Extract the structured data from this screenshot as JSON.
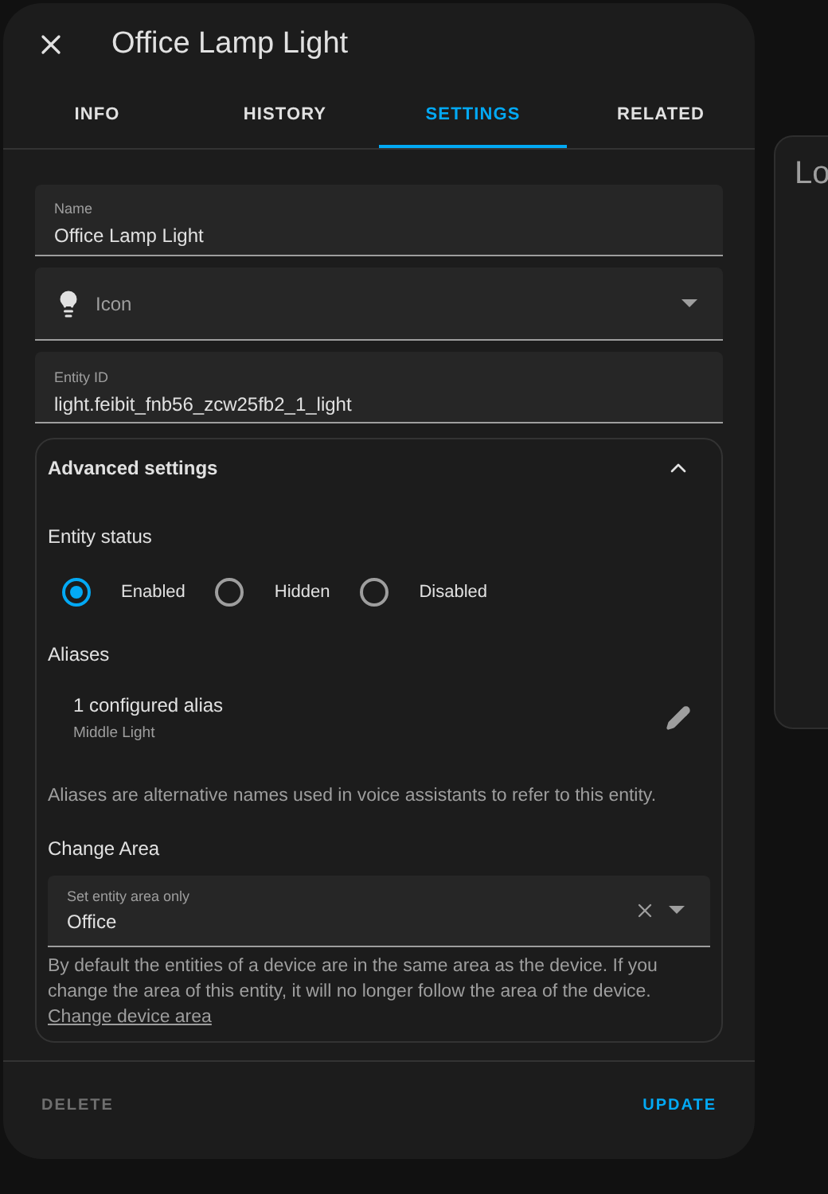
{
  "background_card": {
    "title": "Lo"
  },
  "dialog": {
    "title": "Office Lamp Light"
  },
  "tabs": [
    {
      "label": "INFO",
      "selected": false
    },
    {
      "label": "HISTORY",
      "selected": false
    },
    {
      "label": "SETTINGS",
      "selected": true
    },
    {
      "label": "RELATED",
      "selected": false
    }
  ],
  "name_field": {
    "label": "Name",
    "value": "Office Lamp Light"
  },
  "icon_field": {
    "placeholder": "Icon"
  },
  "entity_id_field": {
    "label": "Entity ID",
    "value": "light.feibit_fnb56_zcw25fb2_1_light"
  },
  "advanced": {
    "title": "Advanced settings",
    "expanded": true,
    "entity_status": {
      "heading": "Entity status",
      "options": [
        {
          "label": "Enabled",
          "selected": true
        },
        {
          "label": "Hidden",
          "selected": false
        },
        {
          "label": "Disabled",
          "selected": false
        }
      ]
    },
    "aliases": {
      "heading": "Aliases",
      "summary": "1 configured alias",
      "detail": "Middle Light",
      "help": "Aliases are alternative names used in voice assistants to refer to this entity."
    },
    "area": {
      "heading": "Change Area",
      "label": "Set entity area only",
      "value": "Office",
      "help": "By default the entities of a device are in the same area as the device. If you change the area of this entity, it will no longer follow the area of the device.",
      "link": "Change device area"
    }
  },
  "footer": {
    "delete": {
      "label": "DELETE",
      "disabled": true
    },
    "update": {
      "label": "UPDATE",
      "disabled": false
    }
  }
}
